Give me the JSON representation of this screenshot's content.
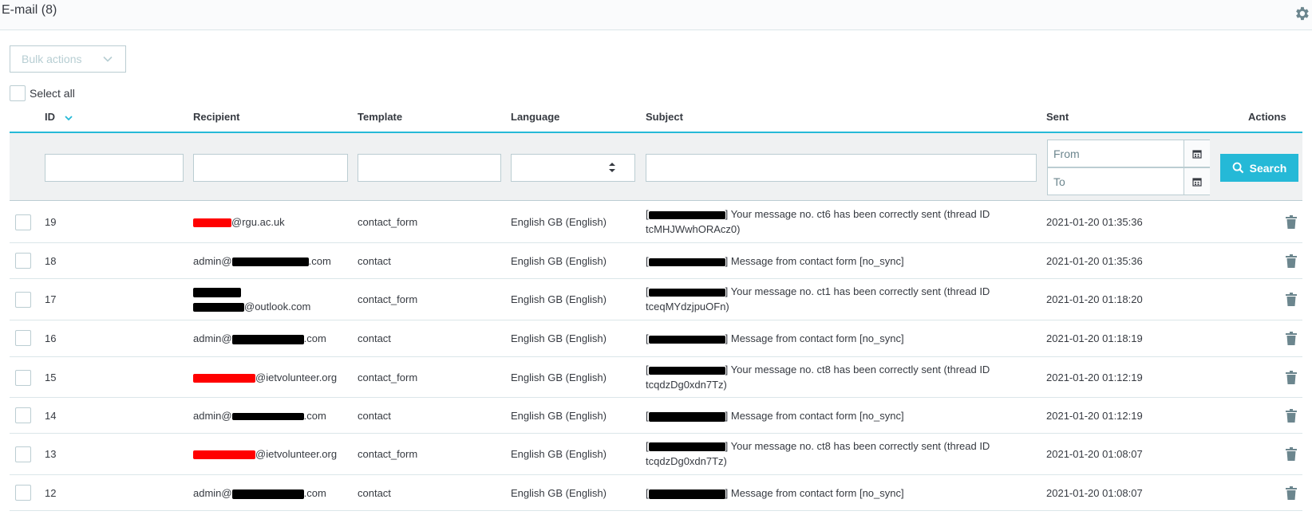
{
  "panel": {
    "title": "E-mail (8)",
    "settings_icon": "gear-icon"
  },
  "toolbar": {
    "bulk_actions_label": "Bulk actions",
    "select_all_label": "Select all"
  },
  "columns": {
    "id": "ID",
    "recipient": "Recipient",
    "template": "Template",
    "language": "Language",
    "subject": "Subject",
    "sent": "Sent",
    "actions": "Actions"
  },
  "filters": {
    "from_placeholder": "From",
    "to_placeholder": "To",
    "search_label": "Search"
  },
  "colors": {
    "accent": "#25b9d7",
    "text": "#363a41",
    "border": "#bbcdd2"
  },
  "rows": [
    {
      "id": "19",
      "recipient_suffix": "@rgu.ac.uk",
      "recipient_prefix": "",
      "template": "contact_form",
      "language": "English GB (English)",
      "subject_line1": "Your message no. ct6 has been correctly sent (thread ID",
      "subject_line2": "tcMHJWwhORAcz0)",
      "sent": "2021-01-20 01:35:36"
    },
    {
      "id": "18",
      "recipient_suffix": ".com",
      "recipient_prefix": "admin@",
      "template": "contact",
      "language": "English GB (English)",
      "subject_line1": "Message from contact form [no_sync]",
      "subject_line2": "",
      "sent": "2021-01-20 01:35:36"
    },
    {
      "id": "17",
      "recipient_suffix": "@outlook.com",
      "recipient_prefix": "",
      "template": "contact_form",
      "language": "English GB (English)",
      "subject_line1": "Your message no. ct1 has been correctly sent (thread ID",
      "subject_line2": "tceqMYdzjpuOFn)",
      "sent": "2021-01-20 01:18:20"
    },
    {
      "id": "16",
      "recipient_suffix": ".com",
      "recipient_prefix": "admin@",
      "template": "contact",
      "language": "English GB (English)",
      "subject_line1": "Message from contact form [no_sync]",
      "subject_line2": "",
      "sent": "2021-01-20 01:18:19"
    },
    {
      "id": "15",
      "recipient_suffix": "@ietvolunteer.org",
      "recipient_prefix": "",
      "template": "contact_form",
      "language": "English GB (English)",
      "subject_line1": "Your message no. ct8 has been correctly sent (thread ID",
      "subject_line2": "tcqdzDg0xdn7Tz)",
      "sent": "2021-01-20 01:12:19"
    },
    {
      "id": "14",
      "recipient_suffix": ".com",
      "recipient_prefix": "admin@",
      "template": "contact",
      "language": "English GB (English)",
      "subject_line1": "Message from contact form [no_sync]",
      "subject_line2": "",
      "sent": "2021-01-20 01:12:19"
    },
    {
      "id": "13",
      "recipient_suffix": "@ietvolunteer.org",
      "recipient_prefix": "",
      "template": "contact_form",
      "language": "English GB (English)",
      "subject_line1": "Your message no. ct8 has been correctly sent (thread ID",
      "subject_line2": "tcqdzDg0xdn7Tz)",
      "sent": "2021-01-20 01:08:07"
    },
    {
      "id": "12",
      "recipient_suffix": ".com",
      "recipient_prefix": "admin@",
      "template": "contact",
      "language": "English GB (English)",
      "subject_line1": "Message from contact form [no_sync]",
      "subject_line2": "",
      "sent": "2021-01-20 01:08:07"
    }
  ]
}
